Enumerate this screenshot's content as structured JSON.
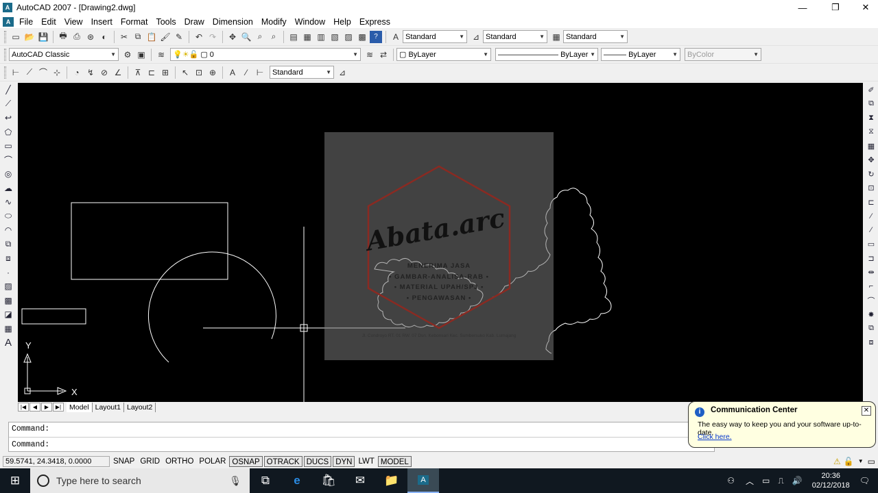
{
  "window": {
    "title": "AutoCAD 2007 - [Drawing2.dwg]",
    "minimize": "—",
    "restore": "❐",
    "close": "✕"
  },
  "menu": [
    "File",
    "Edit",
    "View",
    "Insert",
    "Format",
    "Tools",
    "Draw",
    "Dimension",
    "Modify",
    "Window",
    "Help",
    "Express"
  ],
  "styles": {
    "text_style": "Standard",
    "dim_style": "Standard",
    "table_style": "Standard"
  },
  "workspace": "AutoCAD Classic",
  "layer": "0",
  "properties": {
    "color": "ByLayer",
    "linetype": "ByLayer",
    "lineweight": "ByLayer",
    "plotstyle": "ByColor"
  },
  "dim_toolbar_style": "Standard",
  "axes": {
    "x": "X",
    "y": "Y"
  },
  "layout_tabs": [
    "Model",
    "Layout1",
    "Layout2"
  ],
  "active_tab": "Model",
  "command_lines": [
    "Command:",
    "Command:"
  ],
  "status": {
    "coords": "59.5741, 24.3418, 0.0000",
    "toggles": [
      "SNAP",
      "GRID",
      "ORTHO",
      "POLAR",
      "OSNAP",
      "OTRACK",
      "DUCS",
      "DYN",
      "LWT",
      "MODEL"
    ]
  },
  "balloon": {
    "title": "Communication Center",
    "message": "The easy way to keep you and your software up-to-date.",
    "link": "Click here."
  },
  "watermark": {
    "brand": "Abata.arc",
    "lines": [
      "MENERIMA JASA",
      "• GAMBAR-ANALISA-RAB •",
      "• MATERIAL UPAH/SPJ •",
      "• PENGAWASAN •"
    ],
    "address": "Jl. Condroyo RT. 01 RW. 07 Dsn. Kebonsari Kec. Sumbersuko Kab. Lumajang"
  },
  "taskbar": {
    "search_placeholder": "Type here to search",
    "time": "20:36",
    "date": "02/12/2018"
  },
  "colors": {
    "canvas": "#000000",
    "accent_link": "#0033cc",
    "taskbar": "#101820"
  }
}
